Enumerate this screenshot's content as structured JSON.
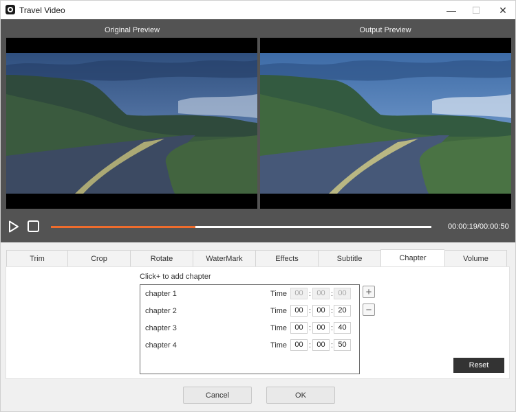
{
  "window": {
    "title": "Travel Video"
  },
  "preview": {
    "original_label": "Original Preview",
    "output_label": "Output Preview",
    "progress": 0.38,
    "progress_color": "#ef6c2c",
    "timecode": "00:00:19/00:00:50"
  },
  "tabs": [
    {
      "label": "Trim"
    },
    {
      "label": "Crop"
    },
    {
      "label": "Rotate"
    },
    {
      "label": "WaterMark"
    },
    {
      "label": "Effects"
    },
    {
      "label": "Subtitle"
    },
    {
      "label": "Chapter",
      "active": true
    },
    {
      "label": "Volume"
    }
  ],
  "chapter_panel": {
    "hint": "Click+ to add chapter",
    "time_label": "Time",
    "chapters": [
      {
        "name": "chapter 1",
        "hh": "00",
        "mm": "00",
        "ss": "00",
        "disabled": true
      },
      {
        "name": "chapter 2",
        "hh": "00",
        "mm": "00",
        "ss": "20"
      },
      {
        "name": "chapter 3",
        "hh": "00",
        "mm": "00",
        "ss": "40"
      },
      {
        "name": "chapter 4",
        "hh": "00",
        "mm": "00",
        "ss": "50"
      }
    ],
    "add_symbol": "+",
    "remove_symbol": "−",
    "reset_label": "Reset"
  },
  "footer": {
    "cancel_label": "Cancel",
    "ok_label": "OK"
  },
  "icons": {
    "app": "app-logo-icon",
    "minimize": "minimize-icon",
    "maximize": "maximize-icon",
    "close": "close-icon",
    "play": "play-icon",
    "stop": "stop-icon"
  }
}
